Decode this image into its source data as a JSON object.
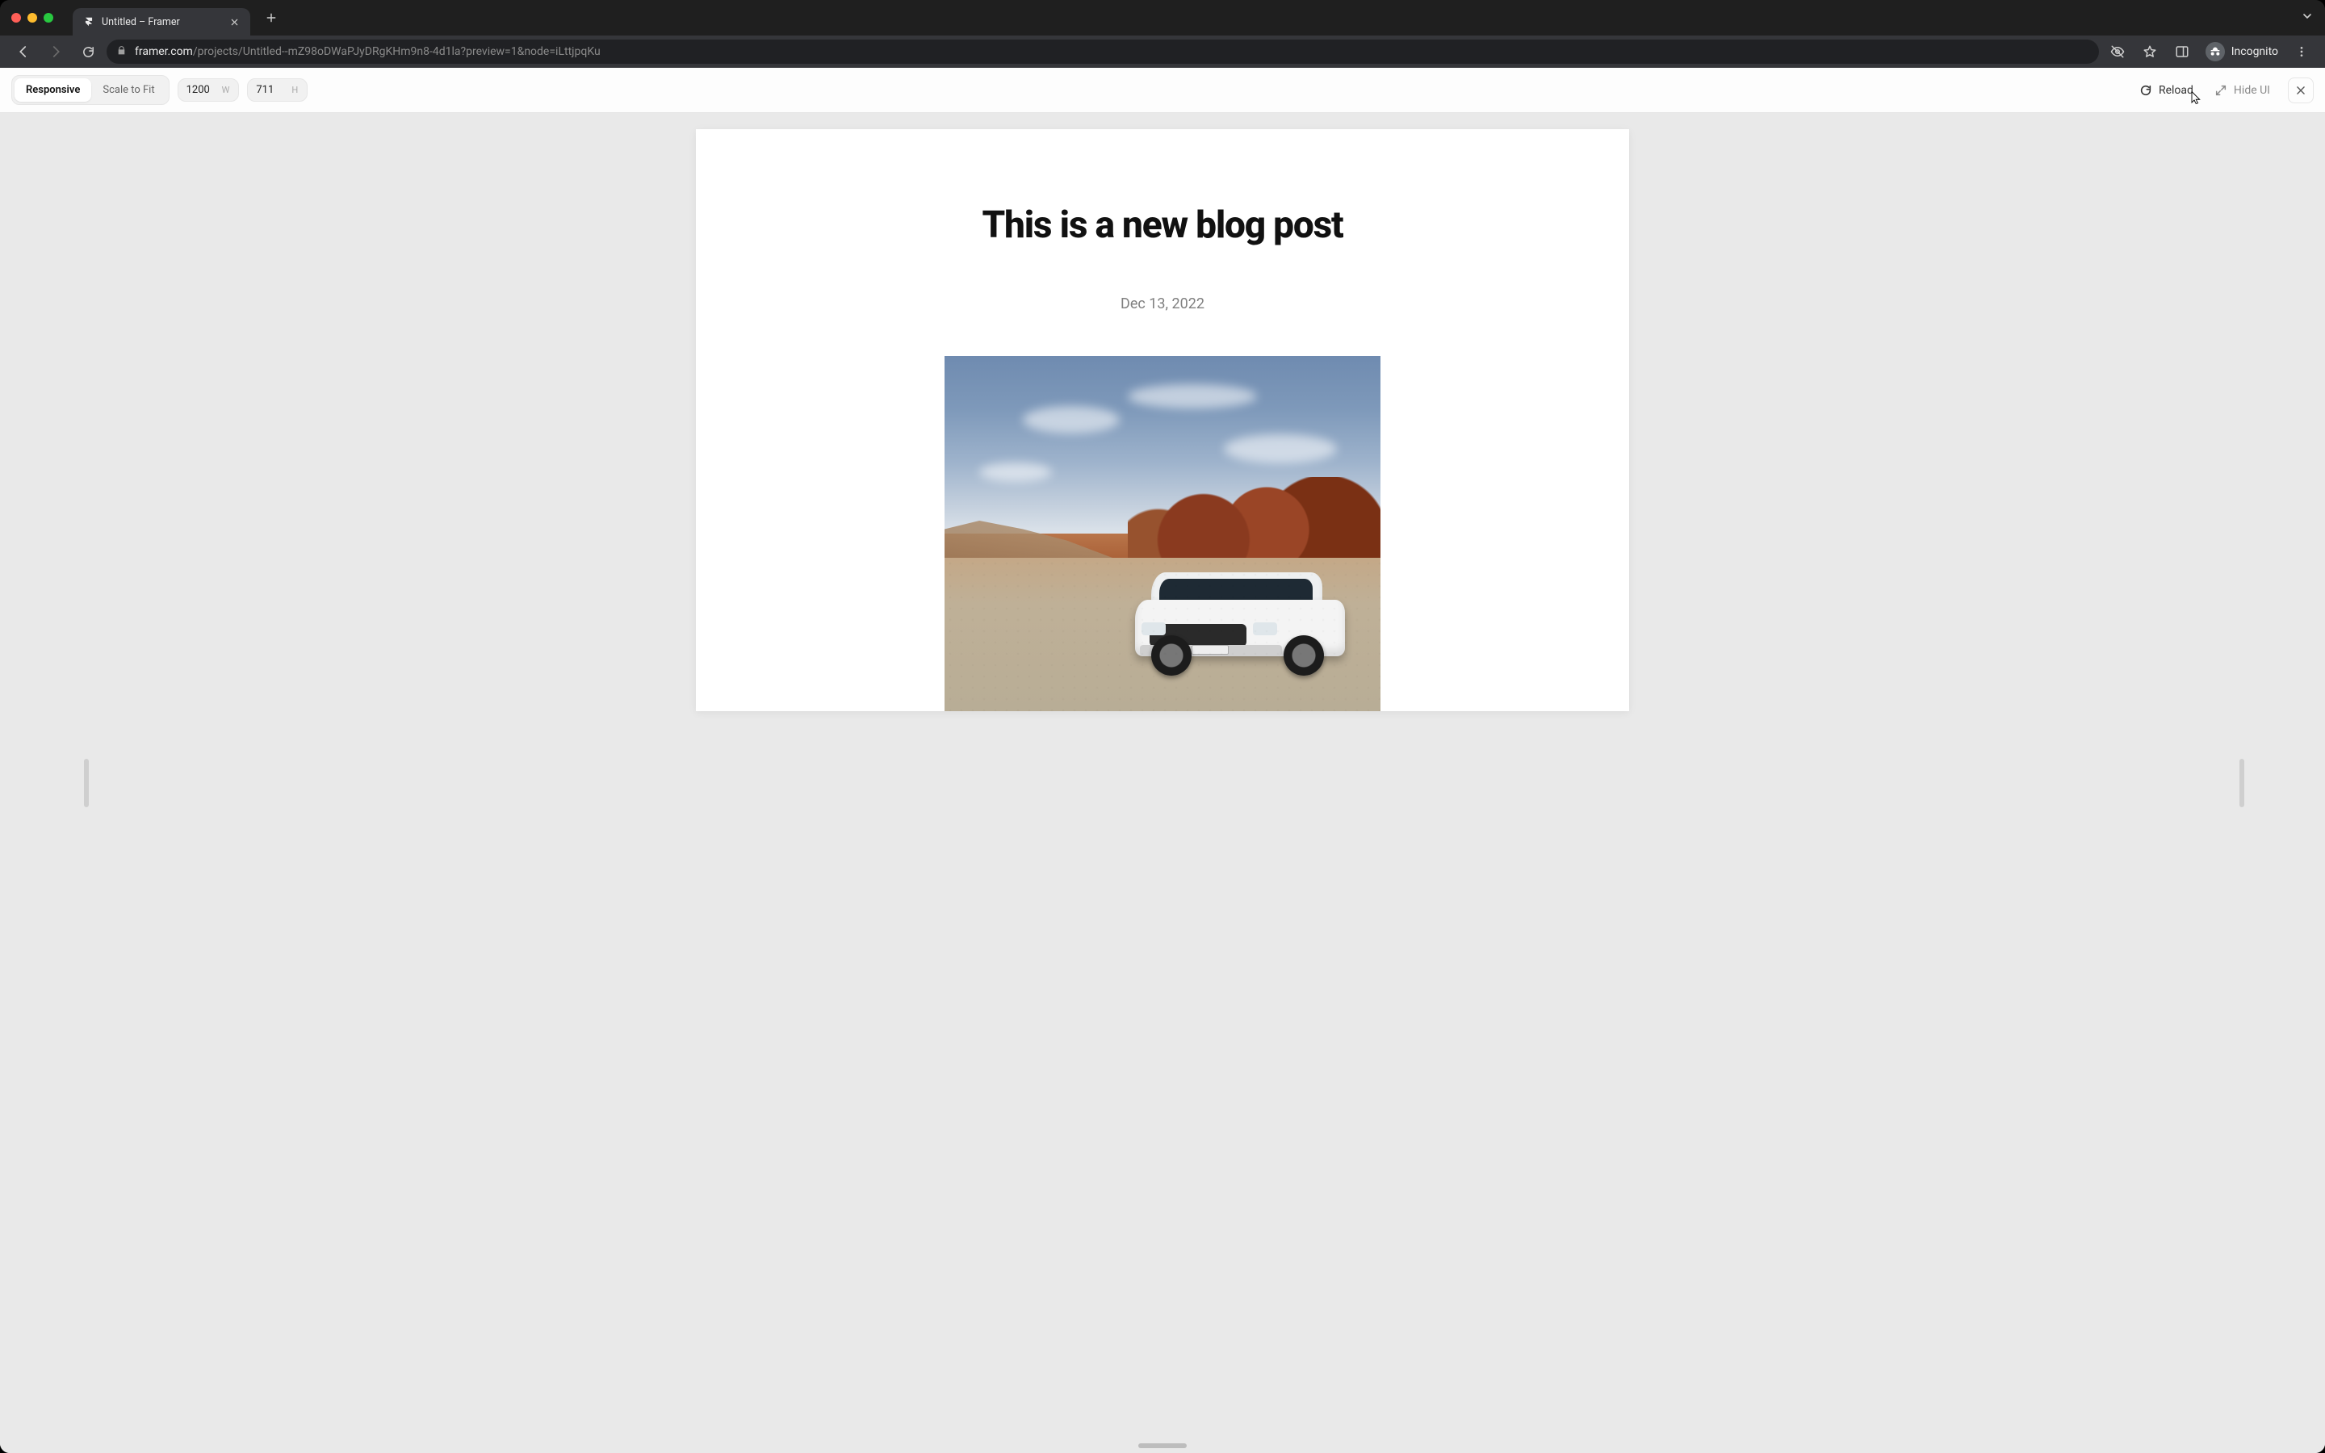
{
  "browser": {
    "tab_title": "Untitled – Framer",
    "url_domain": "framer.com",
    "url_rest": "/projects/Untitled--mZ98oDWaPJyDRgKHm9n8-4d1la?preview=1&node=iLttjpqKu",
    "incognito_label": "Incognito"
  },
  "toolbar": {
    "responsive_label": "Responsive",
    "scale_to_fit_label": "Scale to Fit",
    "width_value": "1200",
    "width_suffix": "W",
    "height_value": "711",
    "height_suffix": "H",
    "reload_label": "Reload",
    "hide_ui_label": "Hide UI"
  },
  "post": {
    "title": "This is a new blog post",
    "date": "Dec 13, 2022",
    "image_alt": "White SUV parked on a gravel road in front of red sandstone rock formations under a blue sky with clouds"
  },
  "colors": {
    "chrome_bg": "#1f1f1f",
    "toolbar_bg": "#35363a",
    "stage_bg": "#e9e9e9",
    "text_muted": "#808080"
  }
}
